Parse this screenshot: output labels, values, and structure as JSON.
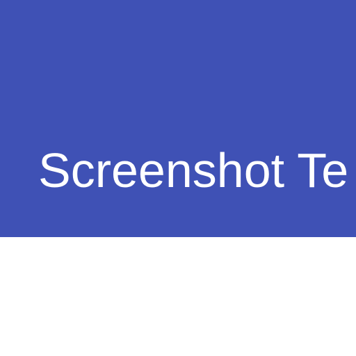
{
  "header": {
    "title": "Screenshot Te",
    "background_color": "#3F51B5",
    "text_color": "#FFFFFF"
  }
}
